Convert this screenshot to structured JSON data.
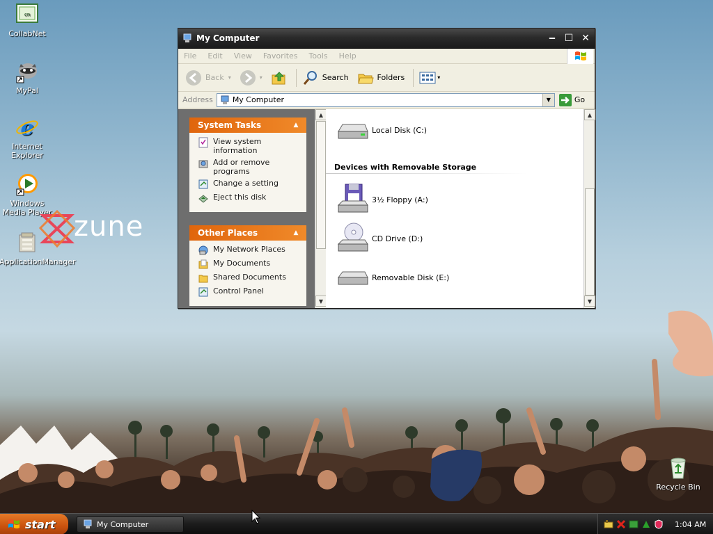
{
  "desktop": {
    "icons": [
      {
        "label": "CollabNet",
        "icon": "collabnet-icon"
      },
      {
        "label": "MyPal",
        "icon": "raccoon-icon"
      },
      {
        "label": "Internet Explorer",
        "icon": "internet-explorer-icon"
      },
      {
        "label": "Windows Media Player",
        "icon": "media-player-icon"
      },
      {
        "label": "ApplicationManager",
        "icon": "application-manager-icon"
      }
    ],
    "recycle_bin": {
      "label": "Recycle Bin"
    },
    "zune_logo": "zune"
  },
  "window": {
    "title": "My Computer",
    "menu": [
      "File",
      "Edit",
      "View",
      "Favorites",
      "Tools",
      "Help"
    ],
    "toolbar": {
      "back": "Back",
      "search": "Search",
      "folders": "Folders"
    },
    "address": {
      "label": "Address",
      "value": "My Computer",
      "go": "Go"
    },
    "system_tasks": {
      "title": "System Tasks",
      "items": [
        "View system information",
        "Add or remove programs",
        "Change a setting",
        "Eject this disk"
      ]
    },
    "other_places": {
      "title": "Other Places",
      "items": [
        "My Network Places",
        "My Documents",
        "Shared Documents",
        "Control Panel"
      ]
    },
    "drives": {
      "local": "Local Disk (C:)",
      "group_title": "Devices with Removable Storage",
      "floppy": "3½ Floppy (A:)",
      "cd": "CD Drive (D:)",
      "removable": "Removable Disk (E:)"
    }
  },
  "taskbar": {
    "start": "start",
    "task": "My Computer",
    "clock": "1:04 AM"
  },
  "colors": {
    "task_pane_header": "#e0650c",
    "titlebar": "#2b2b2b",
    "start_button": "#c9520e"
  }
}
